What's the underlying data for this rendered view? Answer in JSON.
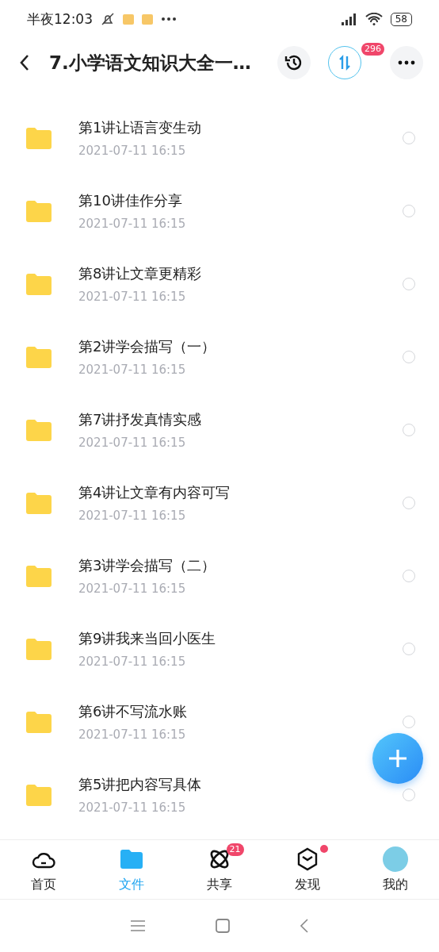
{
  "status_bar": {
    "time": "半夜12:03",
    "battery": "58"
  },
  "header": {
    "title": "7.小学语文知识大全一…",
    "transfer_badge": "296"
  },
  "files": [
    {
      "name": "第1讲让语言变生动",
      "date": "2021-07-11  16:15",
      "selected": false
    },
    {
      "name": "第10讲佳作分享",
      "date": "2021-07-11  16:15",
      "selected": false
    },
    {
      "name": "第8讲让文章更精彩",
      "date": "2021-07-11  16:15",
      "selected": false
    },
    {
      "name": "第2讲学会描写（一）",
      "date": "2021-07-11  16:15",
      "selected": false
    },
    {
      "name": "第7讲抒发真情实感",
      "date": "2021-07-11  16:15",
      "selected": false
    },
    {
      "name": "第4讲让文章有内容可写",
      "date": "2021-07-11  16:15",
      "selected": false
    },
    {
      "name": "第3讲学会描写（二）",
      "date": "2021-07-11  16:15",
      "selected": false
    },
    {
      "name": "第9讲我来当回小医生",
      "date": "2021-07-11  16:15",
      "selected": false
    },
    {
      "name": "第6讲不写流水账",
      "date": "2021-07-11  16:15",
      "selected": false
    },
    {
      "name": "第5讲把内容写具体",
      "date": "2021-07-11  16:15",
      "selected": false
    }
  ],
  "tabs": [
    {
      "kind": "home",
      "label": "首页",
      "selected": false
    },
    {
      "kind": "files",
      "label": "文件",
      "selected": true
    },
    {
      "kind": "share",
      "label": "共享",
      "selected": false,
      "badge": "21"
    },
    {
      "kind": "discover",
      "label": "发现",
      "selected": false,
      "dot": true
    },
    {
      "kind": "me",
      "label": "我的",
      "selected": false
    }
  ]
}
